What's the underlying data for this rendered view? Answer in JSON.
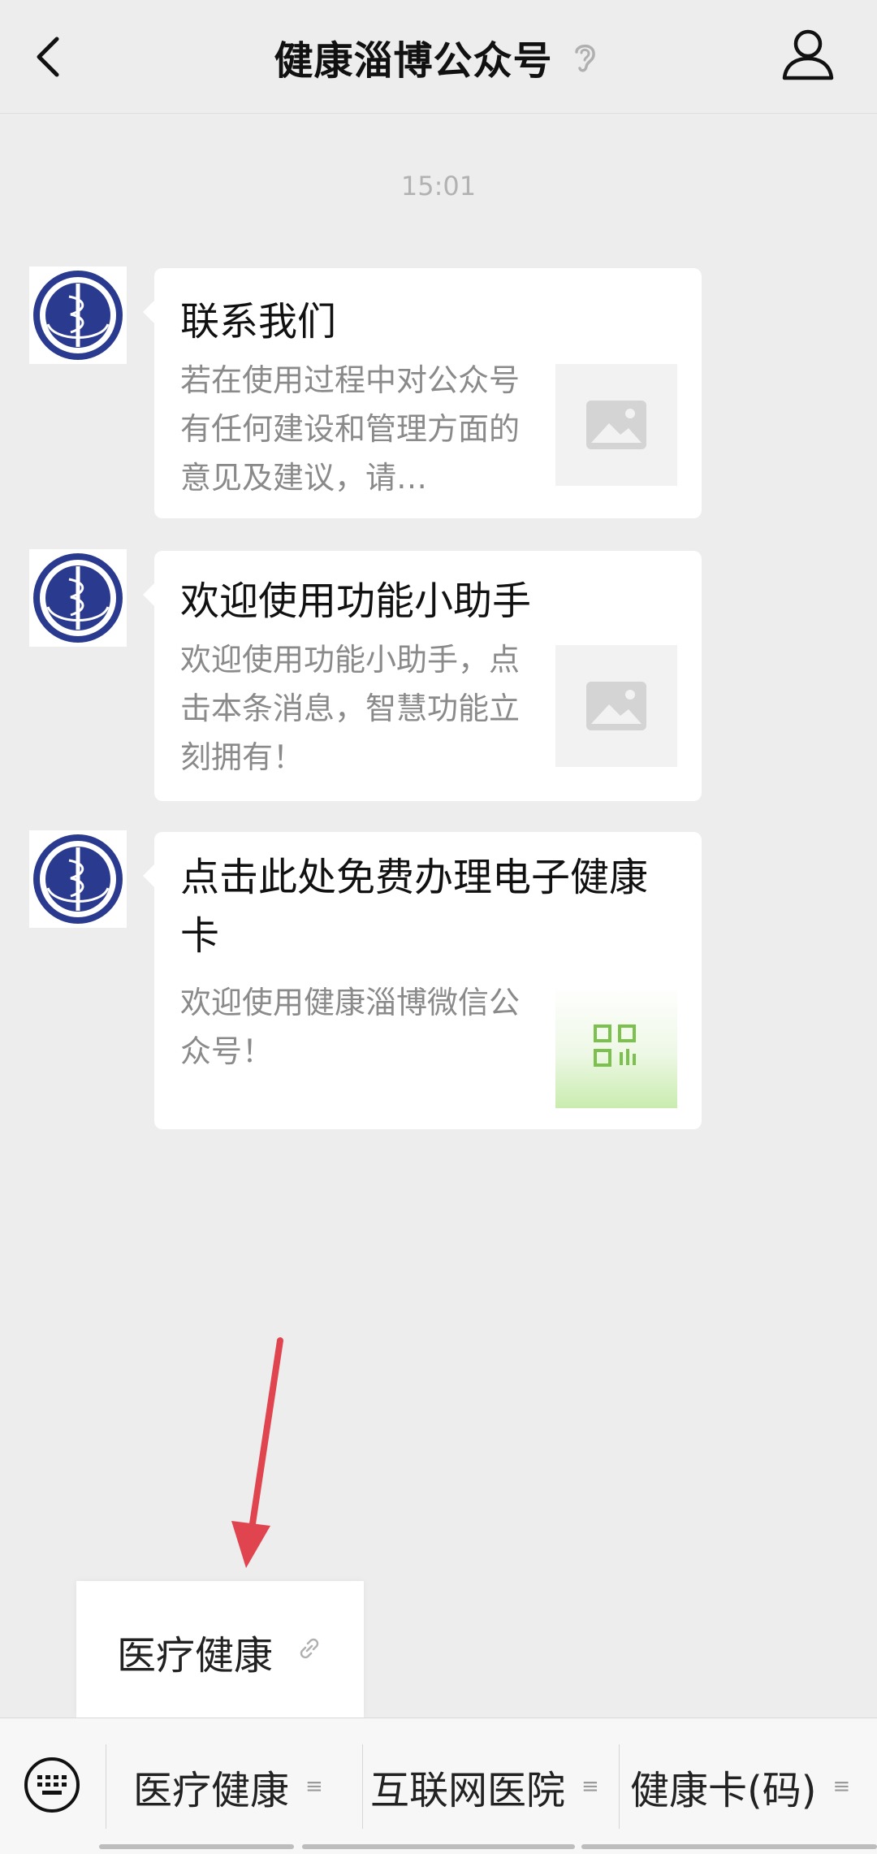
{
  "header": {
    "title": "健康淄博公众号",
    "back_icon": "chevron-left-icon",
    "ear_icon": "ear-icon",
    "profile_icon": "person-icon"
  },
  "chat": {
    "time": "15:01",
    "messages": [
      {
        "title": "联系我们",
        "desc": "若在使用过程中对公众号有任何建设和管理方面的意见及建议，请…",
        "thumb": "image-placeholder-icon"
      },
      {
        "title": "欢迎使用功能小助手",
        "desc": "欢迎使用功能小助手，点击本条消息，智慧功能立刻拥有！",
        "thumb": "image-placeholder-icon"
      },
      {
        "title": "点击此处免费办理电子健康卡",
        "desc": "欢迎使用健康淄博微信公众号！",
        "thumb": "health-card-qr-thumbnail"
      }
    ]
  },
  "popup": {
    "label": "医疗健康",
    "icon": "link-icon"
  },
  "bottom_menu": {
    "keyboard_icon": "keyboard-icon",
    "items": [
      {
        "label": "医疗健康"
      },
      {
        "label": "互联网医院"
      },
      {
        "label": "健康卡(码)"
      }
    ]
  },
  "colors": {
    "background": "#ededed",
    "card": "#ffffff",
    "arrow": "#e0454f"
  }
}
